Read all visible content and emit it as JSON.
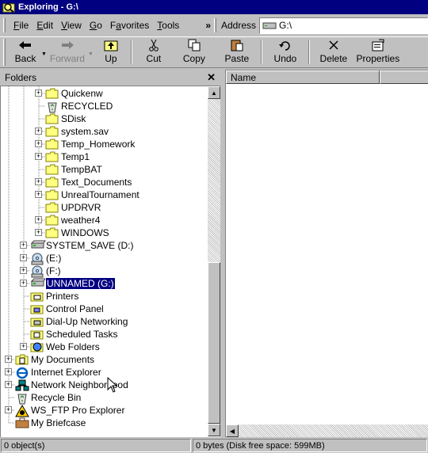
{
  "window": {
    "title": "Exploring - G:\\"
  },
  "menu": [
    {
      "label": "File",
      "u": "F",
      "rest": "ile"
    },
    {
      "label": "Edit",
      "u": "E",
      "rest": "dit"
    },
    {
      "label": "View",
      "u": "V",
      "rest": "iew"
    },
    {
      "label": "Go",
      "u": "G",
      "rest": "o"
    },
    {
      "label": "Favorites",
      "u": "",
      "pre": "F",
      "u2": "a",
      "rest": "vorites"
    },
    {
      "label": "Tools",
      "u": "T",
      "rest": "ools"
    }
  ],
  "menu_overflow": "»",
  "address": {
    "label": "Address",
    "value": "G:\\"
  },
  "toolbar": {
    "back": "Back",
    "forward": "Forward",
    "up": "Up",
    "cut": "Cut",
    "copy": "Copy",
    "paste": "Paste",
    "undo": "Undo",
    "delete": "Delete",
    "properties": "Properties"
  },
  "folders_pane": {
    "title": "Folders",
    "close": "✕"
  },
  "tree": [
    {
      "label": "Quickenw",
      "level": 2,
      "exp": true,
      "icon": "folder-icon"
    },
    {
      "label": "RECYCLED",
      "level": 2,
      "exp": false,
      "icon": "recycle-bin-icon"
    },
    {
      "label": "SDisk",
      "level": 2,
      "exp": false,
      "icon": "folder-icon"
    },
    {
      "label": "system.sav",
      "level": 2,
      "exp": true,
      "icon": "folder-icon"
    },
    {
      "label": "Temp_Homework",
      "level": 2,
      "exp": true,
      "icon": "folder-icon"
    },
    {
      "label": "Temp1",
      "level": 2,
      "exp": true,
      "icon": "folder-icon"
    },
    {
      "label": "TempBAT",
      "level": 2,
      "exp": false,
      "icon": "folder-icon"
    },
    {
      "label": "Text_Documents",
      "level": 2,
      "exp": true,
      "icon": "folder-icon"
    },
    {
      "label": "UnrealTournament",
      "level": 2,
      "exp": true,
      "icon": "folder-icon"
    },
    {
      "label": "UPDRVR",
      "level": 2,
      "exp": false,
      "icon": "folder-icon"
    },
    {
      "label": "weather4",
      "level": 2,
      "exp": true,
      "icon": "folder-icon"
    },
    {
      "label": "WINDOWS",
      "level": 2,
      "exp": true,
      "icon": "folder-icon"
    },
    {
      "label": "SYSTEM_SAVE (D:)",
      "level": 1,
      "exp": true,
      "icon": "drive-icon"
    },
    {
      "label": "(E:)",
      "level": 1,
      "exp": true,
      "icon": "cd-drive-icon"
    },
    {
      "label": "(F:)",
      "level": 1,
      "exp": true,
      "icon": "cd-drive-icon"
    },
    {
      "label": "UNNAMED (G:)",
      "level": 1,
      "exp": true,
      "icon": "drive-icon",
      "selected": true
    },
    {
      "label": "Printers",
      "level": 1,
      "exp": false,
      "icon": "printers-icon"
    },
    {
      "label": "Control Panel",
      "level": 1,
      "exp": false,
      "icon": "control-panel-icon"
    },
    {
      "label": "Dial-Up Networking",
      "level": 1,
      "exp": false,
      "icon": "dialup-icon"
    },
    {
      "label": "Scheduled Tasks",
      "level": 1,
      "exp": false,
      "icon": "scheduled-tasks-icon"
    },
    {
      "label": "Web Folders",
      "level": 1,
      "exp": true,
      "icon": "web-folders-icon"
    },
    {
      "label": "My Documents",
      "level": 0,
      "exp": true,
      "icon": "my-documents-icon"
    },
    {
      "label": "Internet Explorer",
      "level": 0,
      "exp": true,
      "icon": "internet-explorer-icon"
    },
    {
      "label": "Network Neighborhood",
      "level": 0,
      "exp": true,
      "icon": "network-icon"
    },
    {
      "label": "Recycle Bin",
      "level": 0,
      "exp": false,
      "icon": "recycle-bin-icon"
    },
    {
      "label": "WS_FTP Pro Explorer",
      "level": 0,
      "exp": true,
      "icon": "ws-ftp-icon"
    },
    {
      "label": "My Briefcase",
      "level": 0,
      "exp": false,
      "icon": "briefcase-icon"
    }
  ],
  "list_pane": {
    "columns": [
      "Name"
    ]
  },
  "status": {
    "objects": "0 object(s)",
    "disk": "0 bytes (Disk free space: 599MB)"
  },
  "colors": {
    "titlebar": "#000080",
    "face": "#c0c0c0",
    "folder": "#ffff80"
  }
}
